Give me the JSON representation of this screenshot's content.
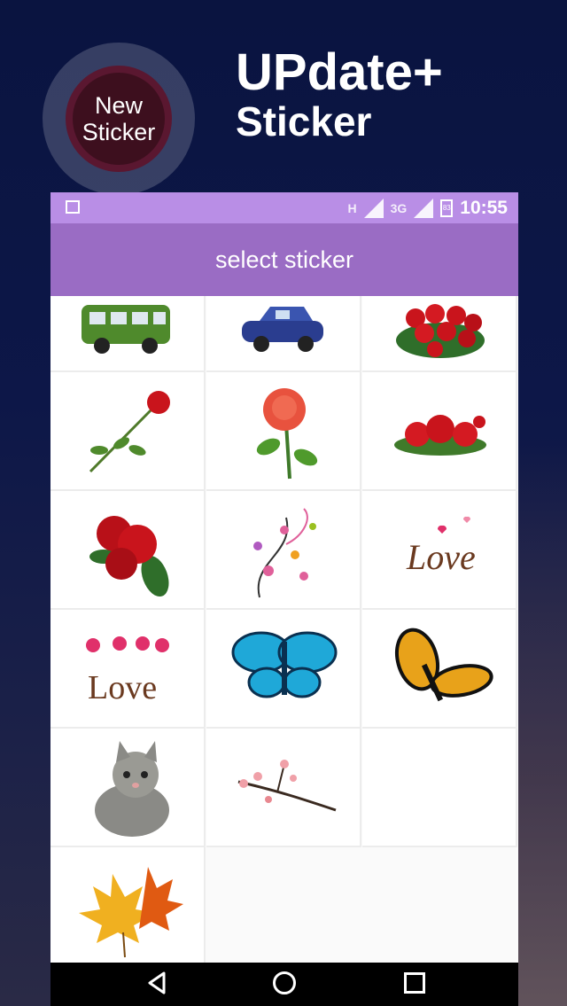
{
  "promo": {
    "badge_line1": "New",
    "badge_line2": "Sticker",
    "headline_line1": "UPdate+",
    "headline_line2": "Sticker"
  },
  "status_bar": {
    "network_h": "H",
    "network_3g": "3G",
    "battery": "83",
    "time": "10:55"
  },
  "toolbar": {
    "title": "select sticker"
  },
  "stickers": [
    {
      "name": "green-bus-sticker"
    },
    {
      "name": "blue-car-sticker"
    },
    {
      "name": "red-roses-bouquet-sticker"
    },
    {
      "name": "single-red-rose-sticker"
    },
    {
      "name": "pink-rose-sticker"
    },
    {
      "name": "red-roses-row-sticker"
    },
    {
      "name": "red-roses-bunch-sticker"
    },
    {
      "name": "floral-swirl-sticker"
    },
    {
      "name": "love-script-sticker",
      "text": "Love"
    },
    {
      "name": "love-hearts-sticker",
      "text": "Love"
    },
    {
      "name": "blue-butterfly-sticker"
    },
    {
      "name": "monarch-butterfly-sticker"
    },
    {
      "name": "kitten-sticker"
    },
    {
      "name": "cherry-blossom-sticker"
    },
    {
      "name": "empty-sticker-slot"
    },
    {
      "name": "autumn-leaves-sticker"
    }
  ],
  "navigation": {
    "back": "back-icon",
    "home": "home-icon",
    "recent": "recent-apps-icon"
  }
}
